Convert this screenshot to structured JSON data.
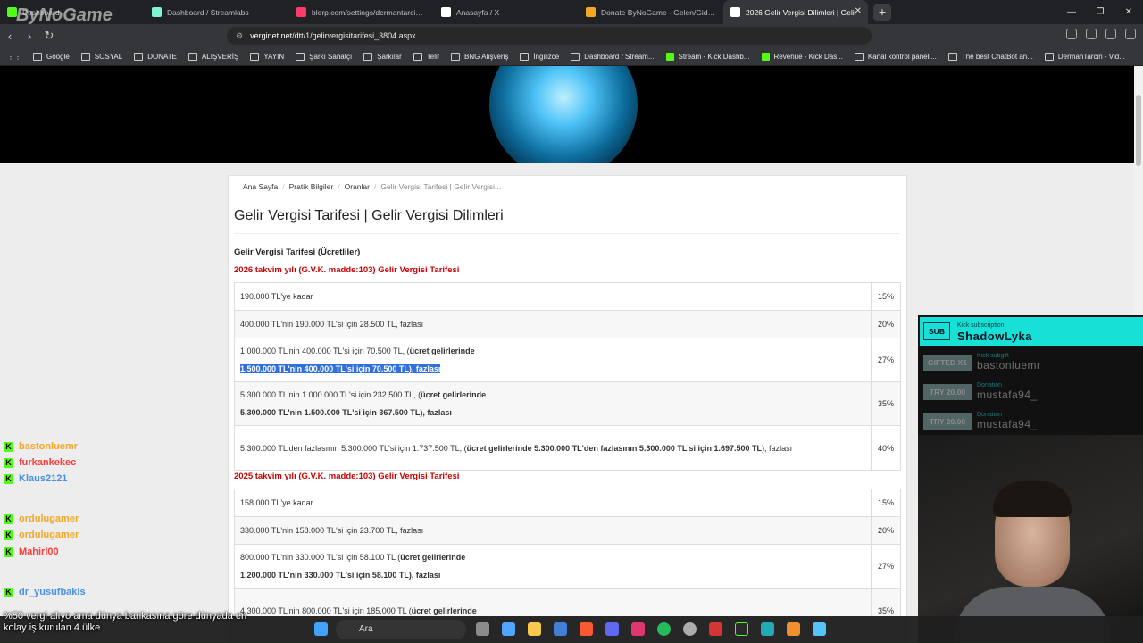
{
  "browser": {
    "tabs": [
      {
        "label": "Dashboard",
        "color": "#53fc18"
      },
      {
        "label": "Dashboard / Streamlabs",
        "color": "#80f5d2"
      },
      {
        "label": "blerp.com/settings/dermantarcin?se",
        "color": "#ff3b6b"
      },
      {
        "label": "Anasayfa / X",
        "color": "#ffffff"
      },
      {
        "label": "Donate ByNoGame - Gelen/Giden B",
        "color": "#f5a623"
      },
      {
        "label": "2026 Gelir Vergisi Dilimleri | Gelir",
        "color": "#ffffff"
      }
    ],
    "url_host": "verginet.net",
    "url_path": "/dtt/1/gelirvergisitarifesi_3804.aspx",
    "bookmarks": [
      "Google",
      "SOSYAL",
      "DONATE",
      "ALIŞVERİŞ",
      "YAYIN",
      "Şarkı Sanatçı",
      "Şarkılar",
      "Telif",
      "BNG Alışveriş",
      "İngilizce",
      "Dashboard / Stream...",
      "Stream - Kick Dashb...",
      "Revenue - Kick Das...",
      "Kanal kontrol paneli...",
      "The best ChatBot an...",
      "DermanTarcin - Vid..."
    ]
  },
  "breadcrumb": [
    "Ana Sayfa",
    "Pratik Bilgiler",
    "Oranlar",
    "Gelir Vergisi Tarifesi | Gelir Vergisi..."
  ],
  "page_title": "Gelir Vergisi Tarifesi | Gelir Vergisi Dilimleri",
  "subtitle": "Gelir Vergisi Tarifesi (Ücretliler)",
  "heading_2026": "2026 takvim yılı (G.V.K. madde:103) Gelir Vergisi Tarifesi",
  "rows_2026": [
    {
      "a": "190.000 TL'ye kadar",
      "b": "",
      "c": "",
      "rate": "15%"
    },
    {
      "a": "400.000 TL'nin 190.000 TL'si için 28.500 TL, fazlası",
      "b": "",
      "c": "",
      "rate": "20%"
    },
    {
      "a": "1.000.000 TL'nin 400.000 TL'si için 70.500 TL, (",
      "b": "ücret gelirlerinde",
      "c": "1.500.000 TL'nin 400.000 TL'si için 70.500 TL), fazlası",
      "rate": "27%"
    },
    {
      "a": "5.300.000 TL'nin 1.000.000 TL'si için 232.500 TL, (",
      "b": "ücret gelirlerinde",
      "c": "5.300.000 TL'nin 1.500.000 TL'si için 367.500 TL), fazlası",
      "rate": "35%"
    },
    {
      "a": "5.300.000 TL'den fazlasının 5.300.000 TL'si için 1.737.500 TL, (",
      "b": "ücret gelirlerinde 5.300.000 TL'den fazlasının 5.300.000 TL'si için 1.697.500 TL",
      "c": "), fazlası",
      "rate": "40%"
    }
  ],
  "heading_2025": "2025 takvim yılı (G.V.K. madde:103) Gelir Vergisi Tarifesi",
  "rows_2025": [
    {
      "a": "158.000 TL'ye kadar",
      "b": "",
      "c": "",
      "rate": "15%"
    },
    {
      "a": "330.000 TL'nin 158.000 TL'si için 23.700 TL, fazlası",
      "b": "",
      "c": "",
      "rate": "20%"
    },
    {
      "a": "800.000 TL'nin 330.000 TL'si için 58.100 TL (",
      "b": "ücret gelirlerinde",
      "c": "1.200.000 TL'nin 330.000 TL'si için 58.100 TL), fazlası",
      "rate": "27%"
    },
    {
      "a": "4.300.000 TL'nin 800.000 TL'si için 185.000 TL (",
      "b": "ücret gelirlerinde",
      "c": "",
      "rate": "35%"
    }
  ],
  "alerts": {
    "sub_badge": "SUB",
    "sub_type": "Kick subscription",
    "sub_name": "ShadowLyka",
    "items": [
      {
        "badge": "GIFTED X1",
        "type": "Kick subgift",
        "name": "bastonluemr"
      },
      {
        "badge": "TRY 20.00",
        "type": "Donation",
        "name": "mustafa94_"
      },
      {
        "badge": "TRY 20.00",
        "type": "Donation",
        "name": "mustafa94_"
      }
    ]
  },
  "chat": [
    {
      "user": "bastonluemr",
      "color": "#f5a623"
    },
    {
      "user": "furkankekec",
      "color": "#ff3b3b"
    },
    {
      "user": "Klaus2121",
      "color": "#4a90e2"
    },
    {
      "user": "ordulugamer",
      "color": "#f5a623"
    },
    {
      "user": "ordulugamer",
      "color": "#f5a623"
    },
    {
      "user": "Mahirl00",
      "color": "#ff3b3b"
    },
    {
      "user": "dr_yusufbakis",
      "color": "#4a90e2"
    }
  ],
  "caption": "%50 vergi alıyo ama dünya bankasına göre dünyada en\nkolay iş kurulan 4.ülke",
  "taskbar": {
    "search": "Ara"
  }
}
